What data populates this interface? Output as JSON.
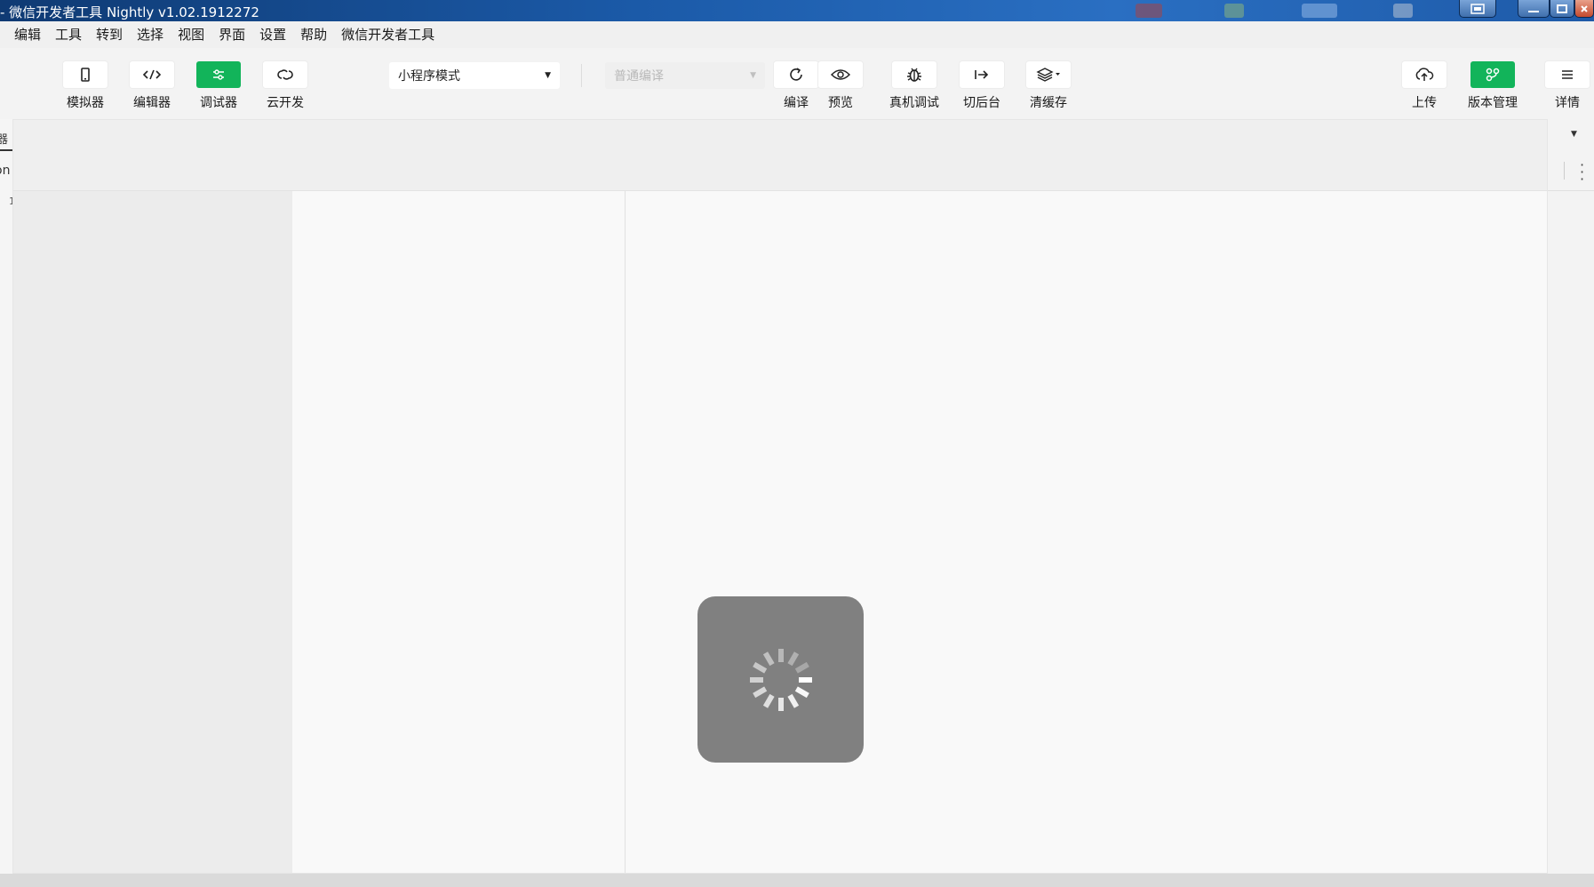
{
  "window": {
    "title": "- 微信开发者工具 Nightly v1.02.1912272",
    "controls": {
      "minimize_icon": "minimize-icon",
      "maximize_icon": "maximize-icon",
      "close_icon": "close-icon"
    }
  },
  "menu": {
    "items": [
      "编辑",
      "工具",
      "转到",
      "选择",
      "视图",
      "界面",
      "设置",
      "帮助",
      "微信开发者工具"
    ]
  },
  "toolbar": {
    "simulator_label": "模拟器",
    "editor_label": "编辑器",
    "debugger_label": "调试器",
    "cloud_label": "云开发",
    "mode_select_value": "小程序模式",
    "compile_select_placeholder": "普通编译",
    "compile_label": "编译",
    "preview_label": "预览",
    "remote_debug_label": "真机调试",
    "background_label": "切后台",
    "clear_cache_label": "清缓存",
    "upload_label": "上传",
    "version_label": "版本管理",
    "details_label": "详情"
  },
  "left_strip": {
    "tab_fragment": "器",
    "label_fragment": "on",
    "row_fragment": "1"
  },
  "loading": {
    "icon": "spinner-icon"
  },
  "colors": {
    "green_accent": "#12b45a",
    "title_bar": "#1b5aa8",
    "loading_bg": "#808080"
  }
}
